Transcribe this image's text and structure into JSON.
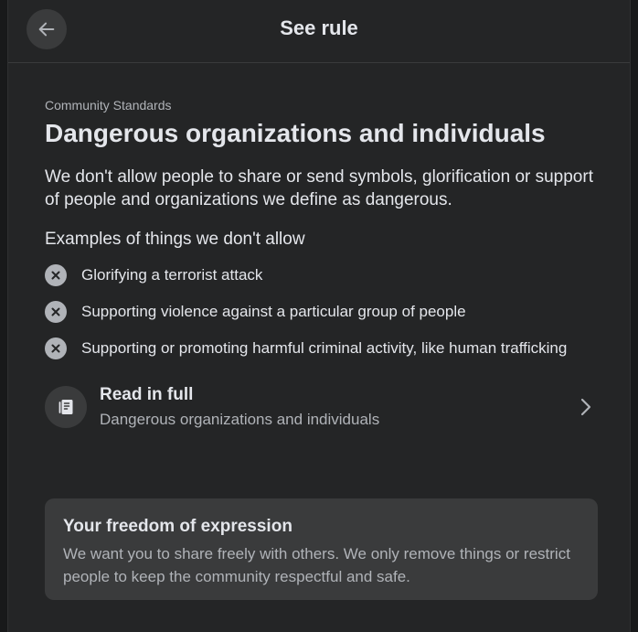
{
  "header": {
    "title": "See rule",
    "back_icon": "arrow-left-icon"
  },
  "rule": {
    "overline": "Community Standards",
    "title": "Dangerous organizations and individuals",
    "description": "We don't allow people to share or send symbols, glorification or support of people and organizations we define as dangerous.",
    "examples_heading": "Examples of things we don't allow",
    "examples": [
      {
        "icon": "x-circle-icon",
        "text": "Glorifying a terrorist attack"
      },
      {
        "icon": "x-circle-icon",
        "text": "Supporting violence against a particular group of people"
      },
      {
        "icon": "x-circle-icon",
        "text": "Supporting or promoting harmful criminal activity, like human trafficking"
      }
    ]
  },
  "read_full": {
    "icon": "document-icon",
    "title": "Read in full",
    "subtitle": "Dangerous organizations and individuals",
    "chevron_icon": "chevron-right-icon"
  },
  "freedom": {
    "title": "Your freedom of expression",
    "body": "We want you to share freely with others. We only remove things or restrict people to keep the community respectful and safe."
  },
  "colors": {
    "background": "#18191a",
    "surface": "#242526",
    "card": "#3a3b3c",
    "text_primary": "#e4e6eb",
    "text_secondary": "#b0b3b8"
  }
}
